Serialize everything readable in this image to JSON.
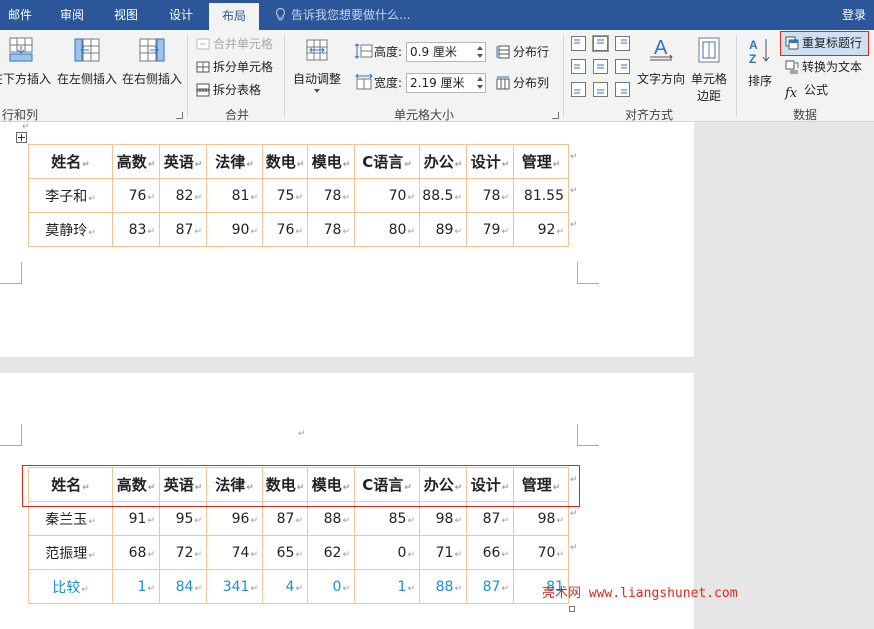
{
  "tabs": [
    {
      "label": "邮件",
      "active": false
    },
    {
      "label": "审阅",
      "active": false
    },
    {
      "label": "视图",
      "active": false
    },
    {
      "label": "设计",
      "active": false
    },
    {
      "label": "布局",
      "active": true
    }
  ],
  "tell_me": "告诉我您想要做什么...",
  "login": "登录",
  "ribbon": {
    "rows_cols": {
      "label": "行和列",
      "insert_below": "在下方插入",
      "insert_left": "在左侧插入",
      "insert_right": "在右侧插入"
    },
    "merge": {
      "label": "合并",
      "merge_cells": "合并单元格",
      "split_cells": "拆分单元格",
      "split_table": "拆分表格"
    },
    "autofit": "自动调整",
    "cell_size": {
      "label": "单元格大小",
      "height_label": "高度:",
      "height_value": "0.9 厘米",
      "width_label": "宽度:",
      "width_value": "2.19 厘米",
      "distribute_rows": "分布行",
      "distribute_cols": "分布列"
    },
    "alignment": {
      "label": "对齐方式",
      "text_direction": "文字方向",
      "cell_margins_line1": "单元格",
      "cell_margins_line2": "边距"
    },
    "data": {
      "label": "数据",
      "sort": "排序",
      "repeat_header": "重复标题行",
      "convert_to_text": "转换为文本",
      "formula": "公式"
    }
  },
  "table_page1": {
    "header": [
      "姓名",
      "高数",
      "英语",
      "法律",
      "数电",
      "模电",
      "C语言",
      "办公",
      "设计",
      "管理"
    ],
    "rows": [
      [
        "李子和",
        "76",
        "82",
        "81",
        "75",
        "78",
        "70",
        "88.5",
        "78",
        "81.55"
      ],
      [
        "莫静玲",
        "83",
        "87",
        "90",
        "76",
        "78",
        "80",
        "89",
        "79",
        "92"
      ]
    ]
  },
  "table_page2": {
    "header": [
      "姓名",
      "高数",
      "英语",
      "法律",
      "数电",
      "模电",
      "C语言",
      "办公",
      "设计",
      "管理"
    ],
    "rows": [
      [
        "秦兰玉",
        "91",
        "95",
        "96",
        "87",
        "88",
        "85",
        "98",
        "87",
        "98"
      ],
      [
        "范振理",
        "68",
        "72",
        "74",
        "65",
        "62",
        "0",
        "71",
        "66",
        "70"
      ]
    ],
    "compare_row": [
      "比较",
      "1",
      "84",
      "341",
      "4",
      "0",
      "1",
      "88",
      "87",
      "81"
    ]
  },
  "watermark": "亮术网 www.liangshunet.com",
  "colors": {
    "title_bar": "#2b579a",
    "cell_border": "#f1c59a",
    "highlight": "#d62a1f",
    "compare_text": "#1b8fd6"
  }
}
